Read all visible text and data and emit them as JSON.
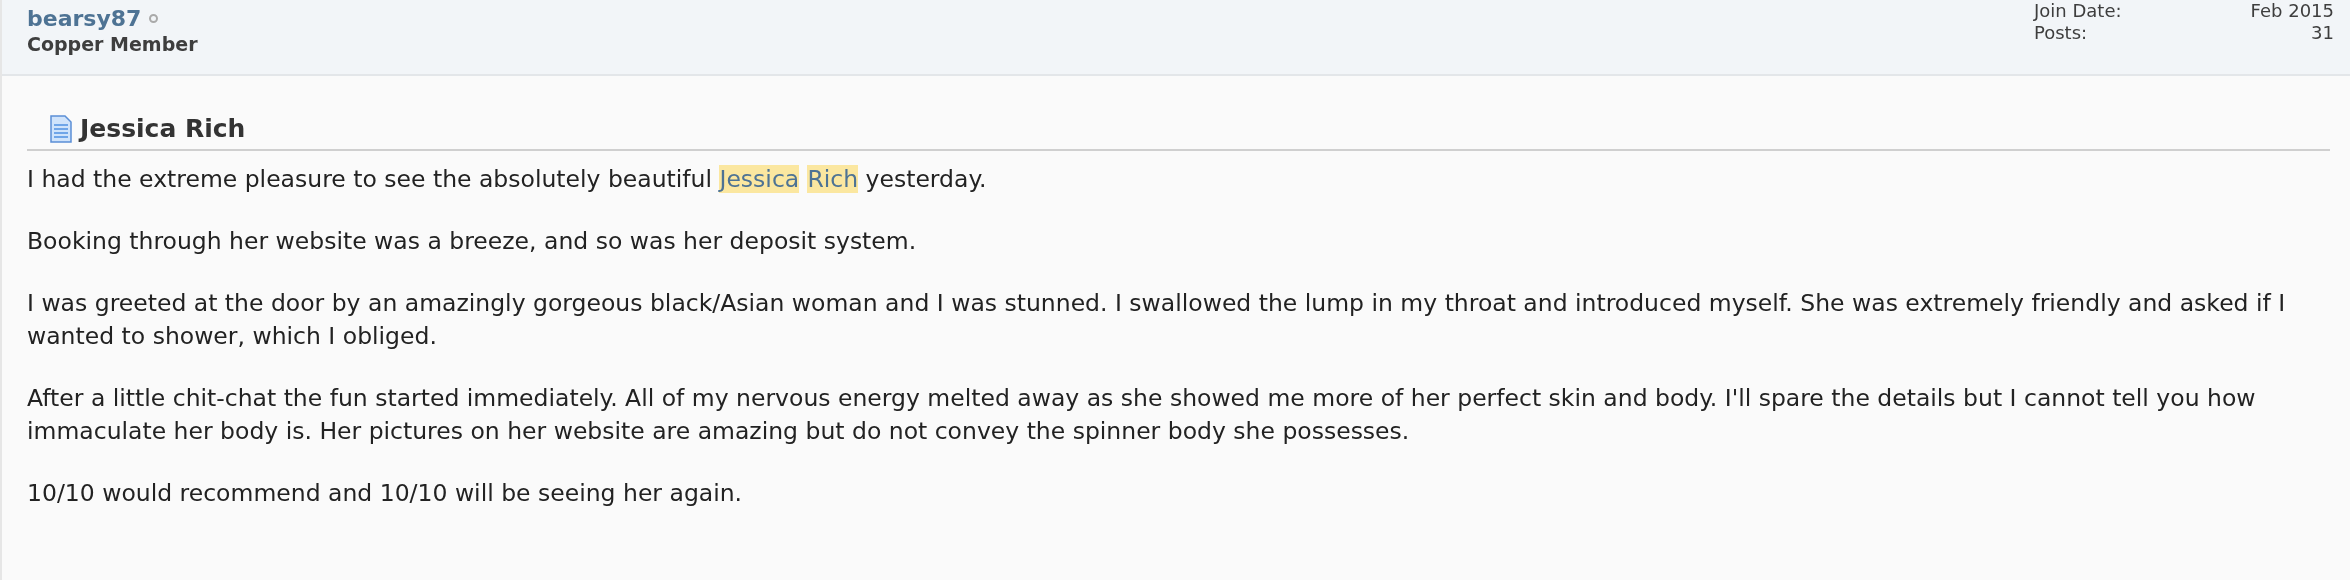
{
  "user": {
    "name": "bearsy87",
    "online": false,
    "rank": "Copper Member"
  },
  "stats": [
    {
      "label": "Join Date:",
      "value": "Feb 2015"
    },
    {
      "label": "Posts:",
      "value": "31"
    }
  ],
  "post": {
    "title": "Jessica Rich",
    "paragraphs": [
      [
        {
          "text": "I had the extreme pleasure to see the absolutely beautiful ",
          "highlighted": false
        },
        {
          "text": "Jessica",
          "highlighted": true
        },
        {
          "text": "Rich",
          "highlighted": true
        },
        {
          "text": " yesterday.",
          "highlighted": false
        }
      ],
      [
        {
          "text": "Booking through her website was a breeze, and so was her deposit system.",
          "highlighted": false
        }
      ],
      [
        {
          "text": "I was greeted at the door by an amazingly gorgeous black/Asian woman and I was stunned. I swallowed the lump in my throat and introduced myself. She was extremely friendly and asked if I wanted to shower, which I obliged.",
          "highlighted": false
        }
      ],
      [
        {
          "text": "After a little chit-chat the fun started immediately. All of my nervous energy melted away as she showed me more of her perfect skin and body. I'll spare the details but I cannot tell you how immaculate her body is. Her pictures on her website are amazing but do not convey the spinner body she possesses.",
          "highlighted": false
        }
      ],
      [
        {
          "text": "10/10 would recommend and 10/10 will be seeing her again.",
          "highlighted": false
        }
      ]
    ]
  }
}
